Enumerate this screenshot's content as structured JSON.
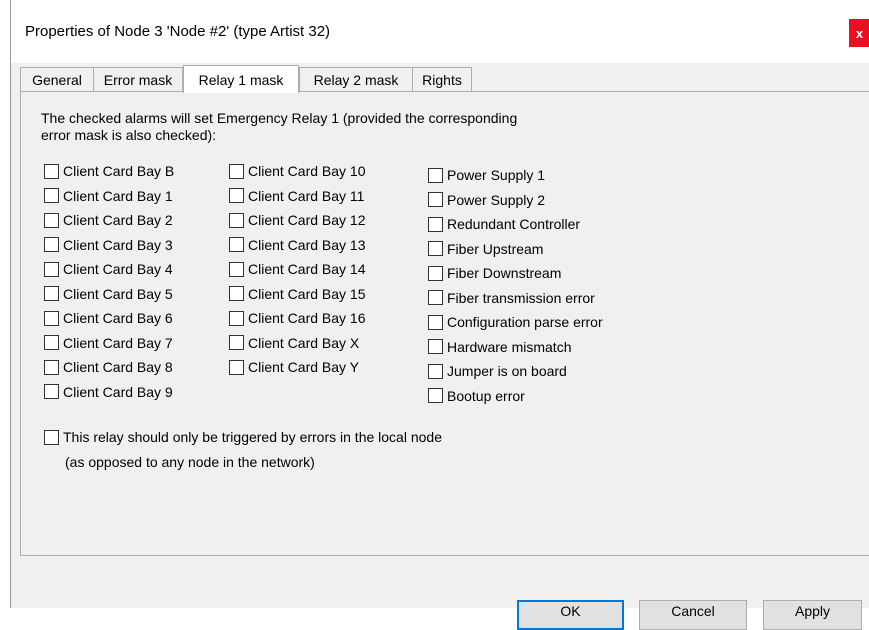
{
  "window": {
    "title": "Properties of Node 3 'Node #2' (type Artist 32)",
    "close_label": "x"
  },
  "tabs": [
    {
      "label": "General",
      "active": false
    },
    {
      "label": "Error mask",
      "active": false
    },
    {
      "label": "Relay 1 mask",
      "active": true
    },
    {
      "label": "Relay 2 mask",
      "active": false
    },
    {
      "label": "Rights",
      "active": false
    }
  ],
  "description": "The checked alarms will set Emergency Relay 1 (provided the corresponding\nerror mask is also checked):",
  "columns": [
    [
      "Client Card Bay B",
      "Client Card Bay 1",
      "Client Card Bay 2",
      "Client Card Bay 3",
      "Client Card Bay 4",
      "Client Card Bay 5",
      "Client Card Bay 6",
      "Client Card Bay 7",
      "Client Card Bay 8",
      "Client Card Bay 9"
    ],
    [
      "Client Card Bay 10",
      "Client Card Bay 11",
      "Client Card Bay 12",
      "Client Card Bay 13",
      "Client Card Bay 14",
      "Client Card Bay 15",
      "Client Card Bay 16",
      "Client Card Bay X",
      "Client Card Bay Y"
    ],
    [
      "Power Supply 1",
      "Power Supply 2",
      "Redundant Controller",
      "Fiber Upstream",
      "Fiber Downstream",
      "Fiber transmission error",
      "Configuration parse error",
      "Hardware mismatch",
      "Jumper is on board",
      "Bootup error"
    ]
  ],
  "local_option": {
    "label": "This relay should only be triggered by errors in the local node",
    "note": "(as opposed to any node in the network)",
    "checked": false
  },
  "buttons": {
    "ok": "OK",
    "cancel": "Cancel",
    "apply": "Apply"
  }
}
